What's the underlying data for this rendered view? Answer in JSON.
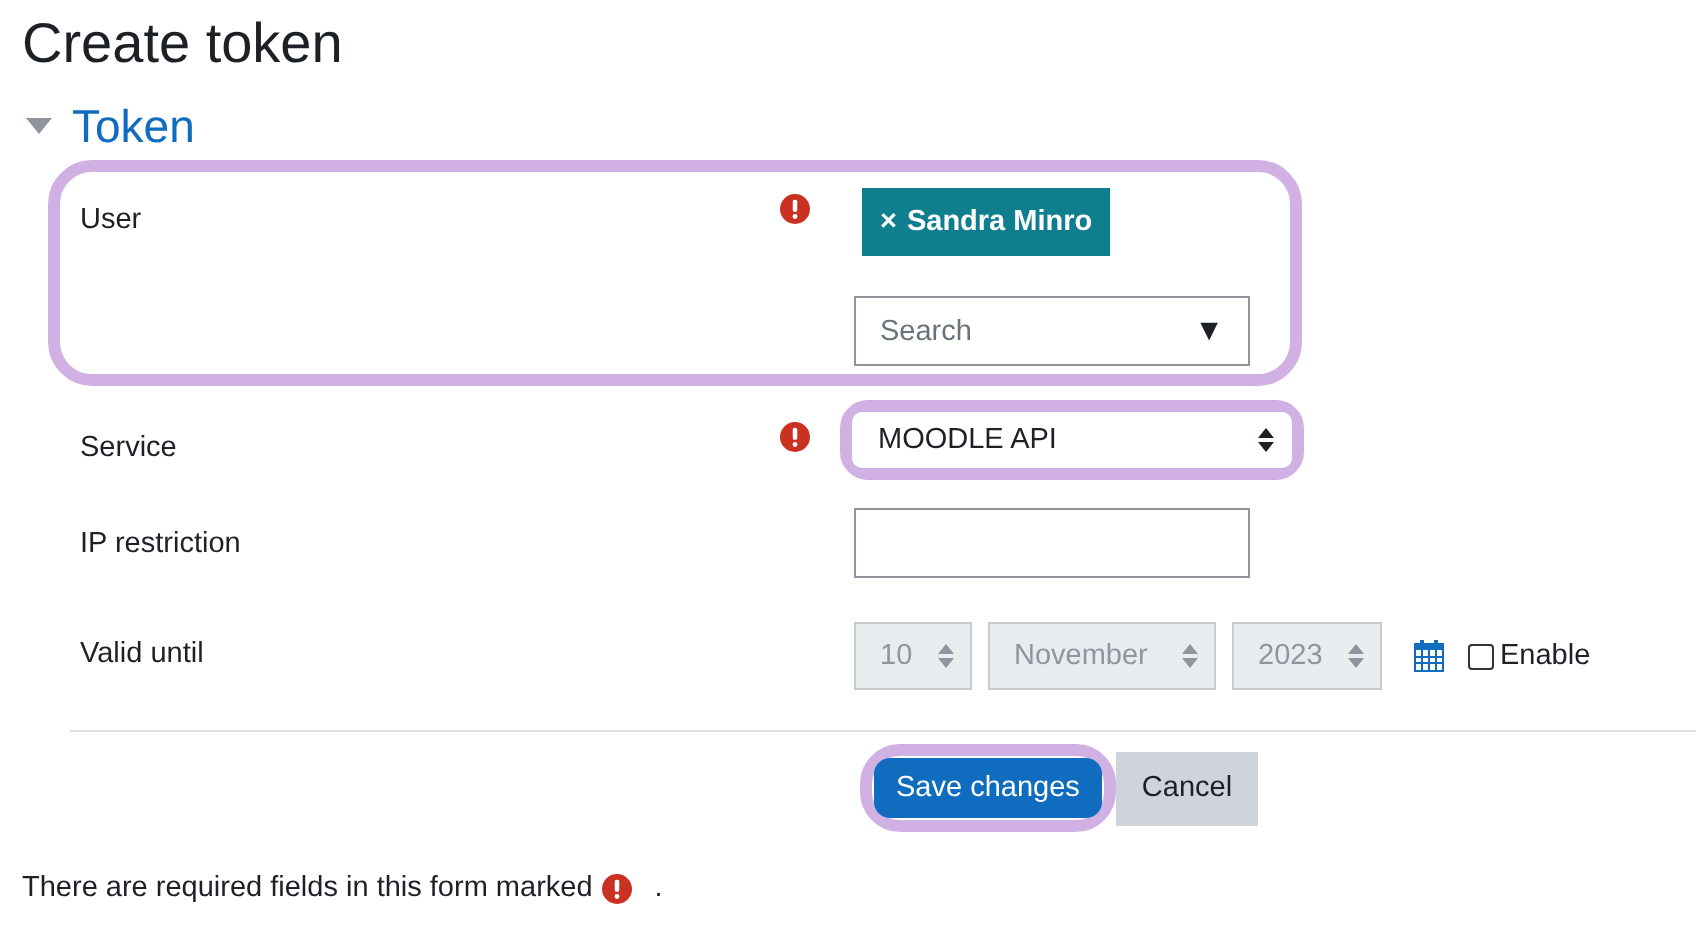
{
  "page_title": "Create token",
  "section": {
    "title": "Token",
    "expanded": true
  },
  "fields": [
    {
      "kind": "autocomplete",
      "label": "User",
      "required": true,
      "highlighted": true,
      "selection": {
        "remove": "×",
        "name": "Sandra Minro"
      },
      "placeholder": "Search",
      "arrow": "▼"
    },
    {
      "kind": "select",
      "label": "Service",
      "required": true,
      "highlighted": true,
      "value": "MOODLE API"
    },
    {
      "kind": "text",
      "label": "IP restriction",
      "required": false
    },
    {
      "kind": "date",
      "label": "Valid until",
      "required": false,
      "disabled": true,
      "day": "10",
      "month": "November",
      "year": "2023",
      "enable": {
        "label": "Enable",
        "checked": false
      }
    }
  ],
  "buttons": [
    {
      "label": "Save changes",
      "primary": true,
      "highlighted": true
    },
    {
      "label": "Cancel",
      "primary": false,
      "highlighted": false
    }
  ],
  "footer": {
    "text": "There are required fields in this form marked",
    "end": "."
  }
}
